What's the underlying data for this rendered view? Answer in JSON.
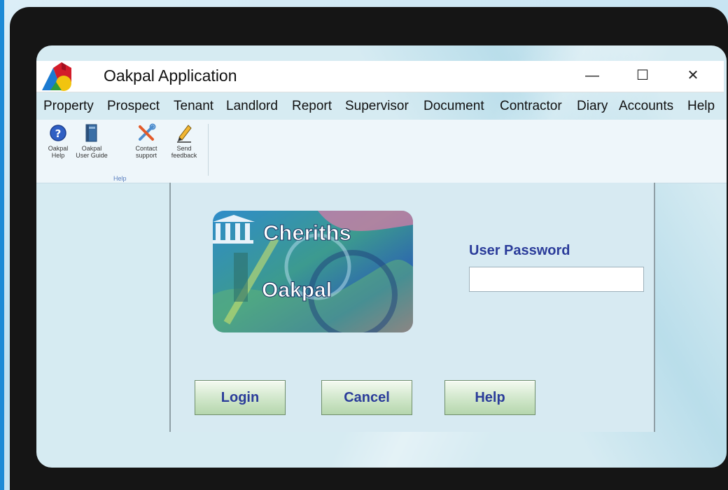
{
  "window": {
    "title": "Oakpal Application",
    "controls": {
      "minimize": "—",
      "maximize": "☐",
      "close": "✕"
    }
  },
  "menu": {
    "items": [
      "Property",
      "Prospect",
      "Tenant",
      "Landlord",
      "Report",
      "Supervisor",
      "Document",
      "Contractor",
      "Diary",
      "Accounts",
      "Help"
    ]
  },
  "ribbon": {
    "buttons": [
      {
        "label": "Oakpal Help",
        "icon": "help-circle-icon"
      },
      {
        "label": "Oakpal User Guide",
        "icon": "book-icon"
      },
      {
        "label": "Contact support",
        "icon": "tools-icon"
      },
      {
        "label": "Send feedback",
        "icon": "pencil-icon"
      }
    ],
    "group_label": "Help"
  },
  "login": {
    "brand_top": "Cheriths",
    "brand_bottom": "Oakpal",
    "password_label": "User Password",
    "password_value": "",
    "buttons": {
      "login": "Login",
      "cancel": "Cancel",
      "help": "Help"
    }
  },
  "colors": {
    "label_blue": "#2b3c9a",
    "button_green": "#cfe6c9",
    "frame": "#151515"
  }
}
